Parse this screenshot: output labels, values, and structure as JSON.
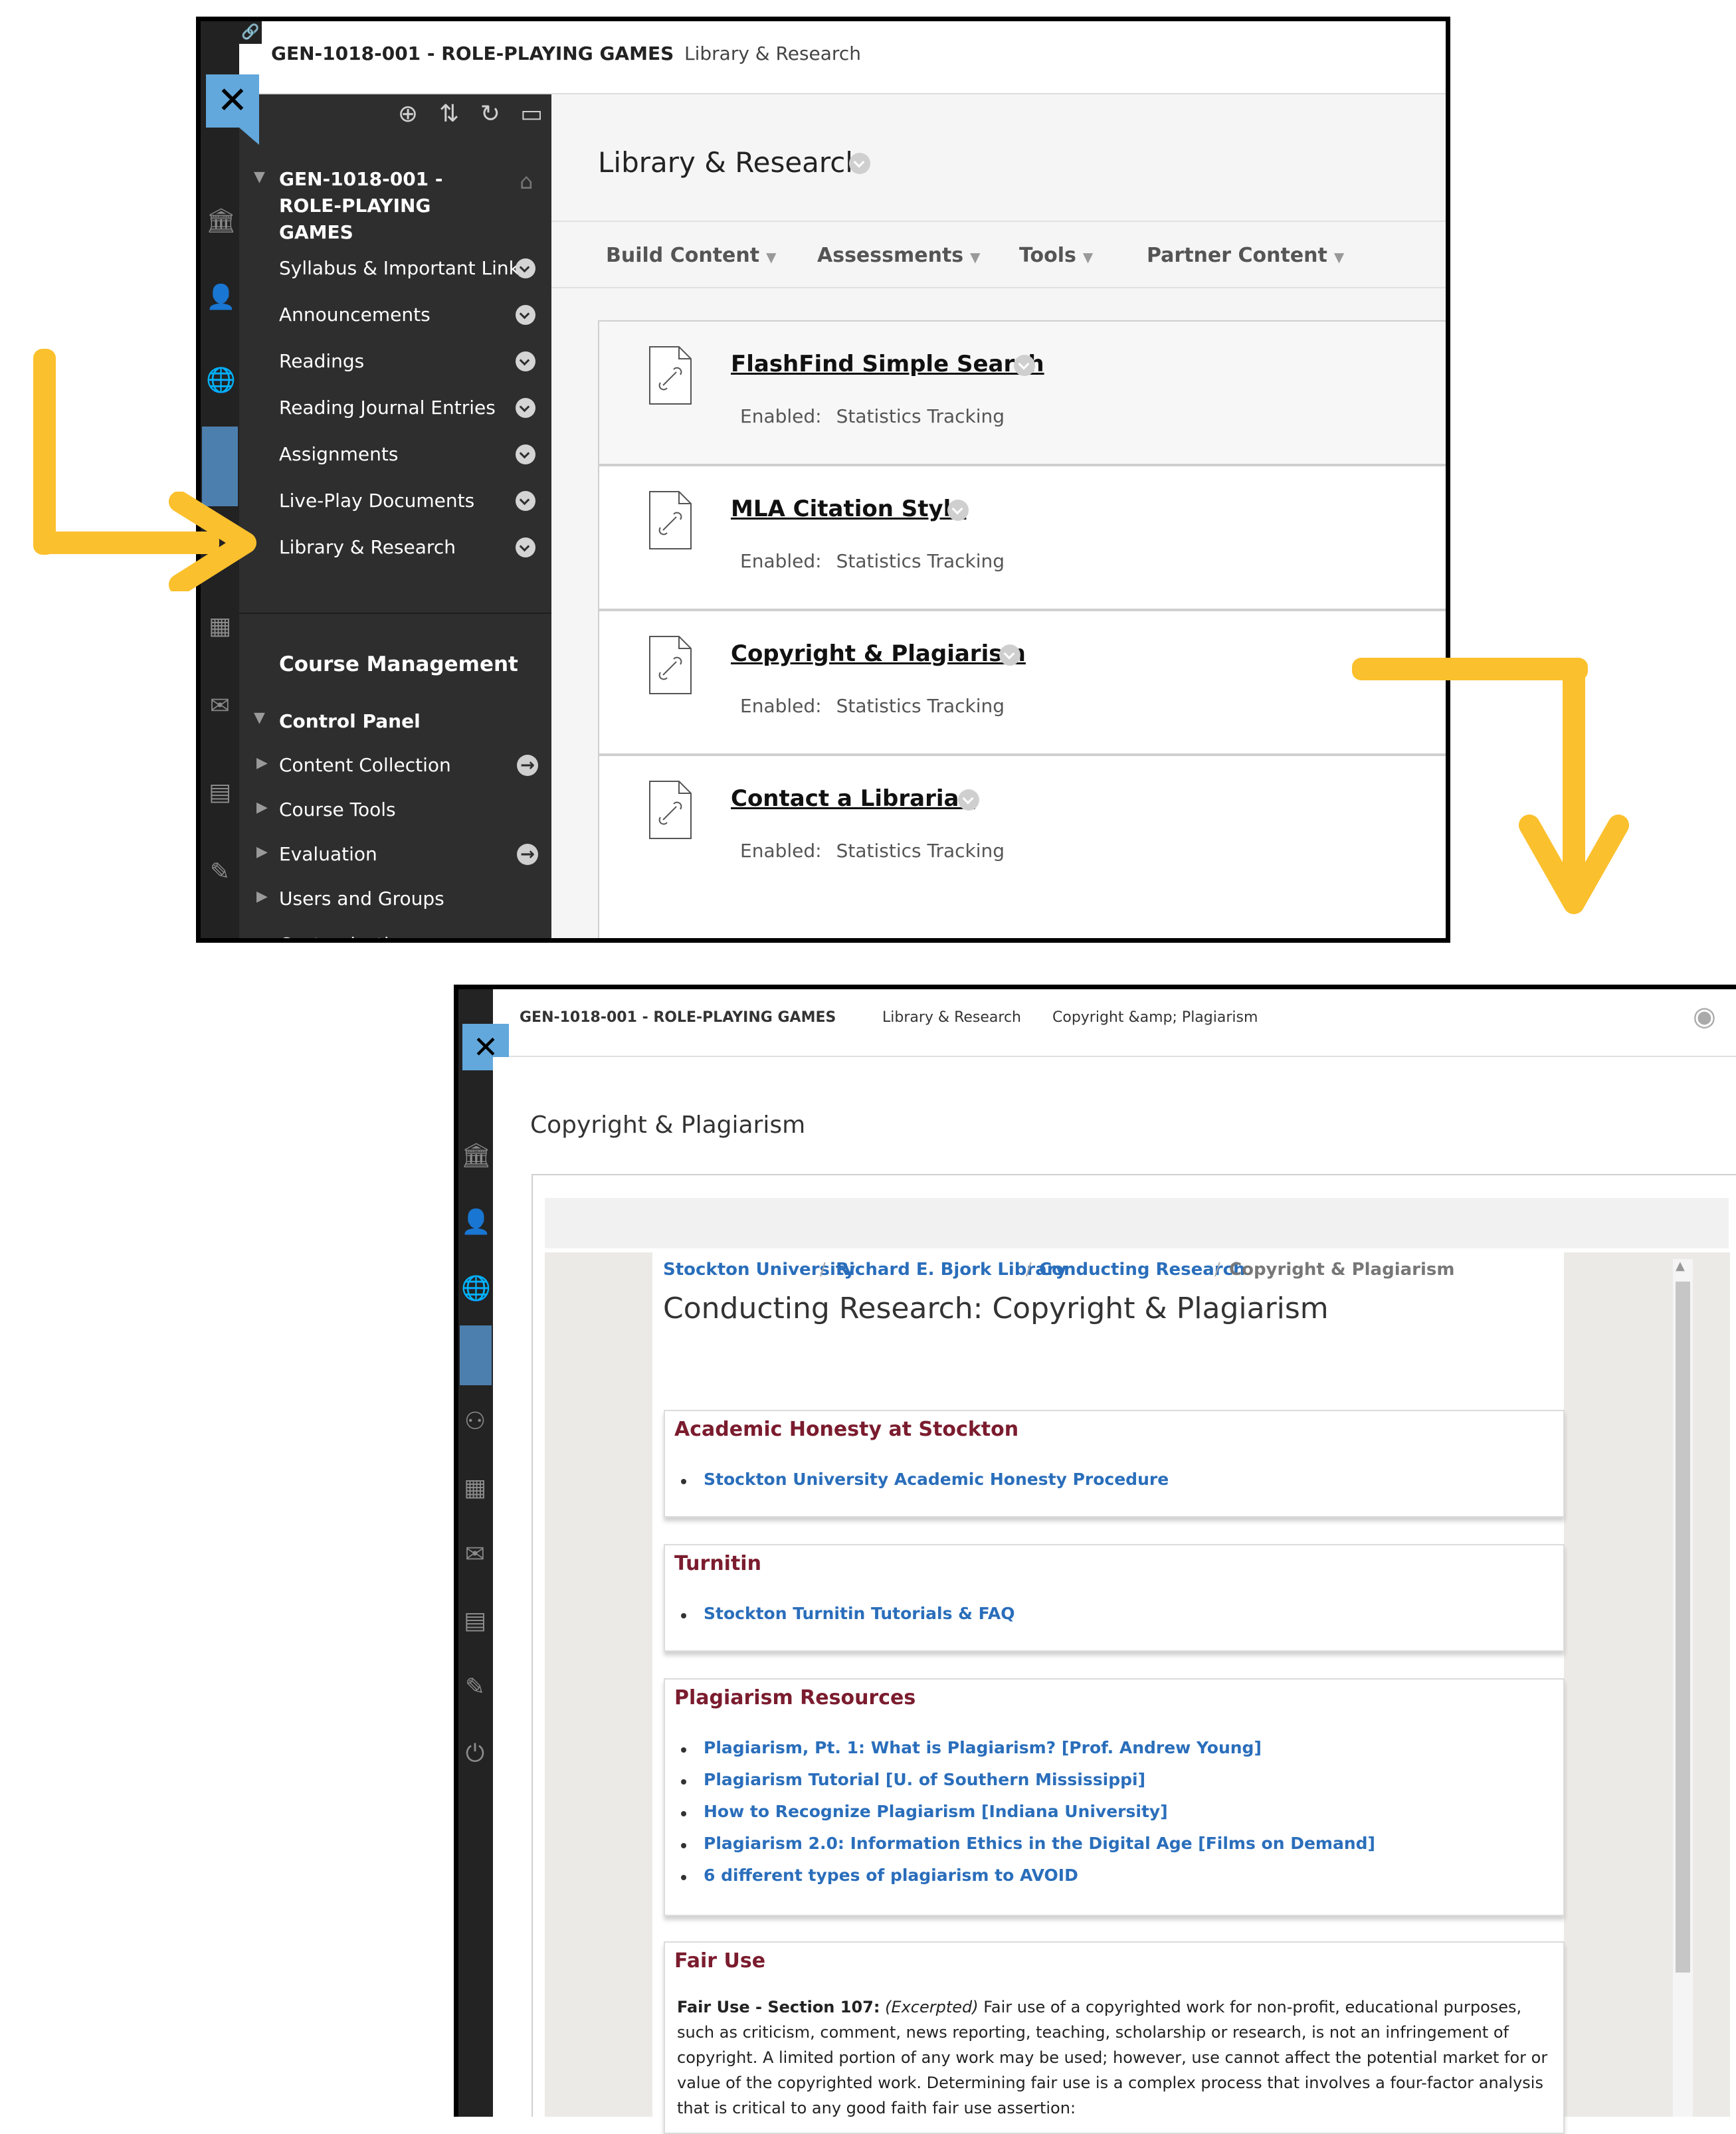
{
  "shot1": {
    "course_code": "GEN-1018-001 - ROLE-PLAYING GAMES",
    "breadcrumb_page": "Library & Research",
    "nav_course_title": "GEN-1018-001 - ROLE-PLAYING GAMES",
    "nav_items": [
      "Syllabus & Important Links",
      "Announcements",
      "Readings",
      "Reading Journal Entries",
      "Assignments",
      "Live-Play Documents",
      "Library & Research"
    ],
    "course_management": "Course Management",
    "control_panel": "Control Panel",
    "panel_items": [
      "Content Collection",
      "Course Tools",
      "Evaluation",
      "Users and Groups",
      "Customization"
    ],
    "page_title": "Library & Research",
    "action_bar": [
      "Build Content",
      "Assessments",
      "Tools",
      "Partner Content"
    ],
    "items": [
      {
        "title": "FlashFind Simple Search",
        "enabled_label": "Enabled:",
        "enabled_value": "Statistics Tracking"
      },
      {
        "title": "MLA Citation Style",
        "enabled_label": "Enabled:",
        "enabled_value": "Statistics Tracking"
      },
      {
        "title": "Copyright & Plagiarism",
        "enabled_label": "Enabled:",
        "enabled_value": "Statistics Tracking"
      },
      {
        "title": "Contact a Librarian",
        "enabled_label": "Enabled:",
        "enabled_value": "Statistics Tracking"
      }
    ]
  },
  "shot2": {
    "breadcrumb": [
      "GEN-1018-001 - ROLE-PLAYING GAMES",
      "Library & Research",
      "Copyright &amp; Plagiarism"
    ],
    "page_title": "Copyright & Plagiarism",
    "lib_breadcrumb": [
      "Stockton University",
      "Richard E. Bjork Library",
      "Conducting Research",
      "Copyright & Plagiarism"
    ],
    "lib_title": "Conducting Research: Copyright & Plagiarism",
    "sections": {
      "academic": {
        "title": "Academic Honesty at Stockton",
        "links": [
          "Stockton University Academic Honesty Procedure"
        ]
      },
      "turnitin": {
        "title": "Turnitin",
        "links": [
          "Stockton Turnitin Tutorials & FAQ"
        ]
      },
      "plagiarism": {
        "title": "Plagiarism Resources",
        "links": [
          "Plagiarism, Pt. 1: What is Plagiarism? [Prof. Andrew Young]",
          "Plagiarism Tutorial [U. of Southern Mississippi]",
          "How to Recognize Plagiarism [Indiana University]",
          "Plagiarism 2.0: Information Ethics in the Digital Age [Films on Demand]",
          "6 different types of plagiarism to AVOID"
        ]
      },
      "fair_use": {
        "title": "Fair Use",
        "lead": "Fair Use - Section 107:",
        "excerpted": "(Excerpted)",
        "text": " Fair use of a copyrighted work for non-profit, educational purposes, such as criticism, comment, news reporting, teaching, scholarship or research, is not an infringement of copyright. A limited portion of any work may be used; however, use cannot affect the potential market for or value of the copyrighted work. Determining fair use is a complex process that involves a four-factor analysis that is critical to any good faith fair use assertion:"
      }
    }
  },
  "colors": {
    "accent_arrow": "#fbc02d",
    "close_button": "#62a8dc",
    "section_title": "#7b1c2e",
    "link": "#2a6ebb"
  }
}
